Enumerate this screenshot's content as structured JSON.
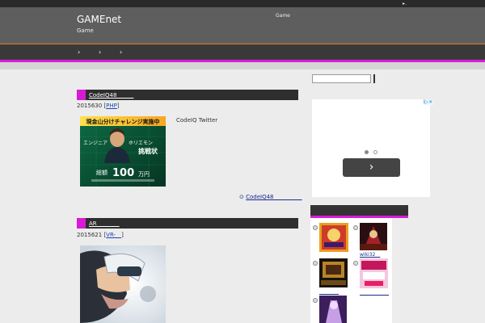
{
  "topbar": {
    "icon_text": "▸."
  },
  "site": {
    "title": "GAMEnet",
    "tagline": "Game",
    "header_link": "Game"
  },
  "nav": {
    "items": [
      "›",
      "›",
      "›"
    ]
  },
  "posts": [
    {
      "title": "CodeIQ48　　　",
      "date": "2015630",
      "category": "PHP",
      "image_texts": [
        "現金山分けチャレンジ実施中",
        "エンジニア",
        "ホリエモン",
        "挑戦状",
        "総額",
        "100",
        "万円"
      ],
      "excerpt": "CodeIQ Twitter",
      "read_more": "CodeIQ48　　　　　"
    },
    {
      "title": "AR　　　　",
      "date": "2015621",
      "category": "VR-　"
    }
  ],
  "sidebar": {
    "search_placeholder": "",
    "ad_badge": "i▷✕",
    "ad_next": "›",
    "game_links": [
      "　　　　",
      "wiki32　",
      "　　　　",
      "　　　　　　"
    ]
  },
  "colors": {
    "accent": "#d91ad4",
    "header_border": "#e07a1e",
    "link": "#1a44b8"
  }
}
